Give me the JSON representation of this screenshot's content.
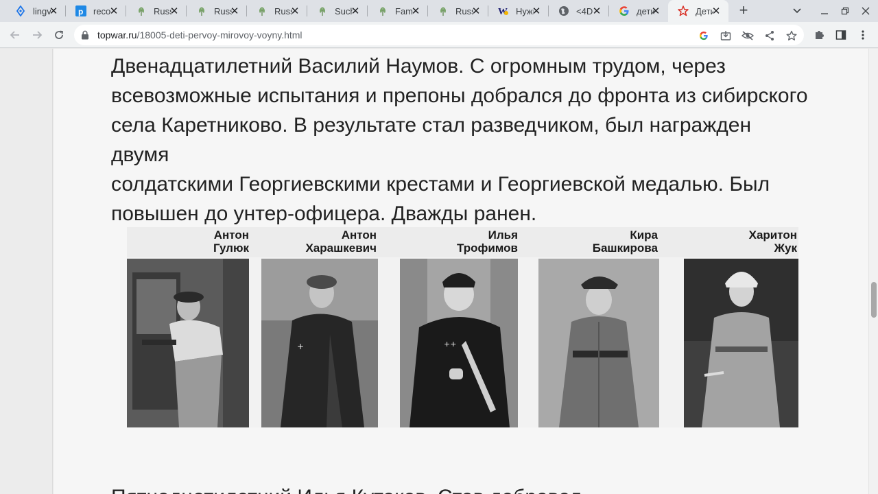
{
  "browser": {
    "tabs": [
      {
        "title": "lingvo",
        "icon": "lingvo-diamond-icon",
        "active": false
      },
      {
        "title": "recognition",
        "icon": "p-logo-icon",
        "active": false
      },
      {
        "title": "Russian",
        "icon": "leaf-icon",
        "active": false
      },
      {
        "title": "Russian",
        "icon": "leaf-icon",
        "active": false
      },
      {
        "title": "Russian",
        "icon": "leaf-icon",
        "active": false
      },
      {
        "title": "Such",
        "icon": "leaf-icon",
        "active": false
      },
      {
        "title": "Family",
        "icon": "leaf-icon",
        "active": false
      },
      {
        "title": "Russian",
        "icon": "leaf-icon",
        "active": false
      },
      {
        "title": "Нужно",
        "icon": "wikipedia-icon",
        "active": false
      },
      {
        "title": "<4D",
        "icon": "globe-icon",
        "active": false
      },
      {
        "title": "дети",
        "icon": "google-icon",
        "active": false
      },
      {
        "title": "Дети",
        "icon": "red-star-icon",
        "active": true
      }
    ],
    "new_tab_label": "+",
    "address": {
      "host": "topwar.ru",
      "path": "/18005-deti-pervoy-mirovoy-voyny.html"
    }
  },
  "article": {
    "paragraph_lines": [
      "Двенадцатилетний Василий Наумов. С огромным трудом, через",
      "всевозможные испытания и препоны добрался до фронта из сибирского",
      "села Каретниково. В результате стал разведчиком, был награжден двумя",
      "солдатскими Георгиевскими крестами и Георгиевской медалью. Был",
      "повышен до унтер-офицера. Дважды ранен."
    ],
    "next_paragraph_partial": "Пятнадцатилетний              Илья  Кутаков.  Став              добровол",
    "photo_captions": [
      {
        "first": "Антон",
        "last": "Гулюк"
      },
      {
        "first": "Антон",
        "last": "Харашкевич"
      },
      {
        "first": "Илья",
        "last": "Трофимов"
      },
      {
        "first": "Кира",
        "last": "Башкирова"
      },
      {
        "first": "Харитон",
        "last": "Жук"
      }
    ]
  },
  "colors": {
    "tabstrip": "#dee1e6",
    "toolbar": "#f1f3f4",
    "active_tab_star": "#d93025",
    "page_bg": "#f6f6f6",
    "text": "#222222"
  }
}
